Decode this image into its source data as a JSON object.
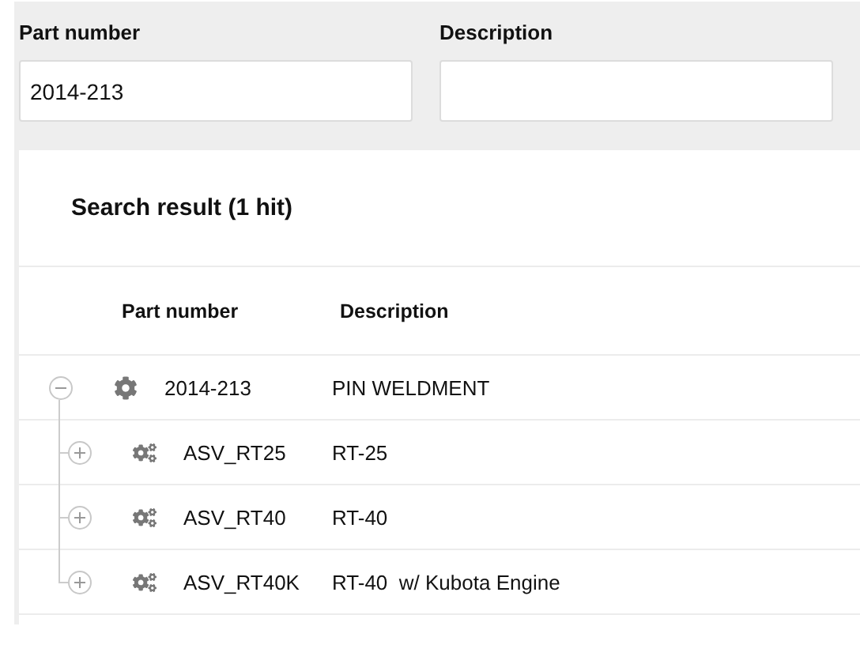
{
  "filters": [
    {
      "label": "Part number",
      "value": "2014-213"
    },
    {
      "label": "Description"
    }
  ],
  "result": {
    "title": "Search result (1 hit)",
    "columns": [
      "Part number",
      "Description"
    ],
    "rows": [
      {
        "kind": "assembly",
        "part": "2014-213",
        "description": "PIN WELDMENT",
        "expanded": true,
        "children": [
          {
            "kind": "group",
            "part": "ASV_RT25",
            "description": "RT-25",
            "expanded": false
          },
          {
            "kind": "group",
            "part": "ASV_RT40",
            "description": "RT-40",
            "expanded": false
          },
          {
            "kind": "group",
            "part": "ASV_RT40K",
            "description": "RT-40  w/ Kubota Engine",
            "expanded": false
          }
        ]
      }
    ]
  }
}
